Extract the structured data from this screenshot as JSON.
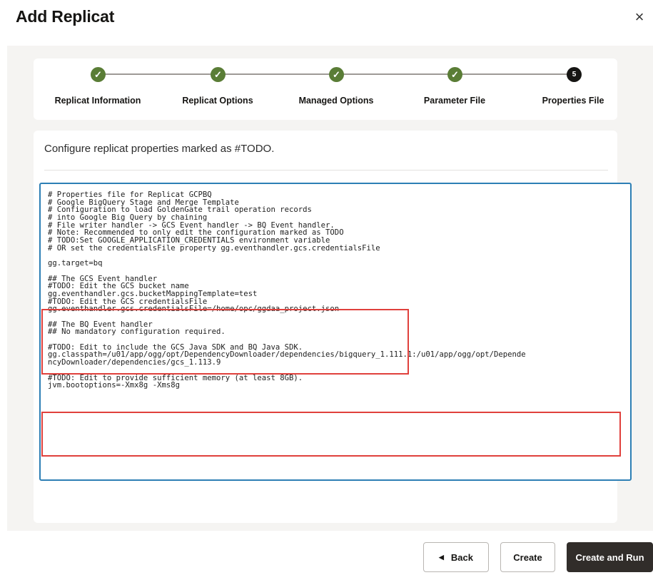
{
  "dialog": {
    "title": "Add Replicat",
    "close_icon": "×"
  },
  "stepper": {
    "steps": [
      {
        "label": "Replicat Information",
        "state": "done",
        "marker": "✓"
      },
      {
        "label": "Replicat Options",
        "state": "done",
        "marker": "✓"
      },
      {
        "label": "Managed Options",
        "state": "done",
        "marker": "✓"
      },
      {
        "label": "Parameter File",
        "state": "done",
        "marker": "✓"
      },
      {
        "label": "Properties File",
        "state": "current",
        "marker": "5"
      }
    ],
    "colors": {
      "done": "#5a7d36",
      "current": "#161513"
    }
  },
  "content": {
    "instruction": "Configure replicat properties marked as #TODO.",
    "lines": [
      "# Properties file for Replicat GCPBQ",
      "# Google BigQuery Stage and Merge Template",
      "# Configuration to load GoldenGate trail operation records",
      "# into Google Big Query by chaining",
      "# File writer handler -> GCS Event handler -> BQ Event handler.",
      "# Note: Recommended to only edit the configuration marked as TODO",
      "# TODO:Set GOOGLE_APPLICATION_CREDENTIALS environment variable",
      "# OR set the credentialsFile property gg.eventhandler.gcs.credentialsFile",
      "",
      "gg.target=bq",
      "",
      "## The GCS Event handler",
      "#TODO: Edit the GCS bucket name",
      "gg.eventhandler.gcs.bucketMappingTemplate=test",
      "#TODO: Edit the GCS credentialsFile",
      "gg.eventhandler.gcs.credentialsFile=/home/opc/ggdaa_project.json",
      "",
      "## The BQ Event handler",
      "## No mandatory configuration required.",
      "",
      "#TODO: Edit to include the GCS Java SDK and BQ Java SDK.",
      "gg.classpath=/u01/app/ogg/opt/DependencyDownloader/dependencies/bigquery_1.111.1:/u01/app/ogg/opt/Depende",
      "ncyDownloader/dependencies/gcs_1.113.9",
      "",
      "#TODO: Edit to provide sufficient memory (at least 8GB).",
      "jvm.bootoptions=-Xmx8g -Xms8g"
    ]
  },
  "footer": {
    "back_label": "Back",
    "back_icon": "◀",
    "create_label": "Create",
    "create_and_run_label": "Create and Run"
  }
}
